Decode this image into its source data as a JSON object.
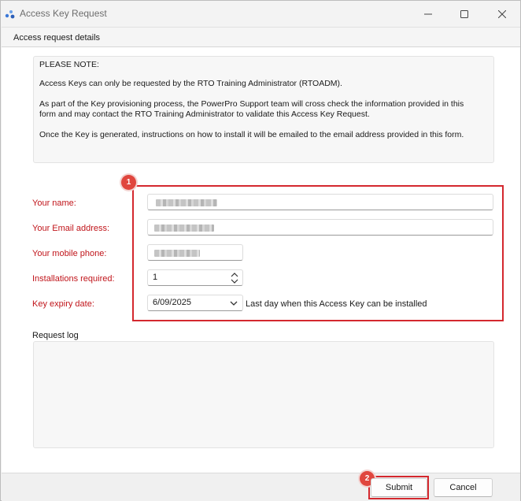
{
  "window": {
    "title": "Access Key Request"
  },
  "tab": {
    "label": "Access request details"
  },
  "note": {
    "heading": "PLEASE NOTE:",
    "line1": "Access Keys can only be requested by the RTO Training Administrator (RTOADM).",
    "line2a": "As part of the Key provisioning process, the PowerPro Support team will cross check the information provided in this",
    "line2b": "form and may contact the RTO Training Administrator to validate this Access Key Request.",
    "line3": "Once the Key is generated, instructions on how to install it will be emailed to the email address provided in this form."
  },
  "form": {
    "name_label": "Your name:",
    "email_label": "Your Email address:",
    "phone_label": "Your mobile phone:",
    "installs_label": "Installations required:",
    "installs_value": "1",
    "expiry_label": "Key expiry date:",
    "expiry_value": "6/09/2025",
    "expiry_note": "Last day when this Access Key can be installed"
  },
  "log": {
    "label": "Request log"
  },
  "buttons": {
    "submit": "Submit",
    "cancel": "Cancel"
  },
  "annotations": {
    "badge1": "1",
    "badge2": "2"
  },
  "colors": {
    "label_red": "#c0141a",
    "highlight_red": "#d4282e",
    "badge_red": "#e0463e"
  }
}
